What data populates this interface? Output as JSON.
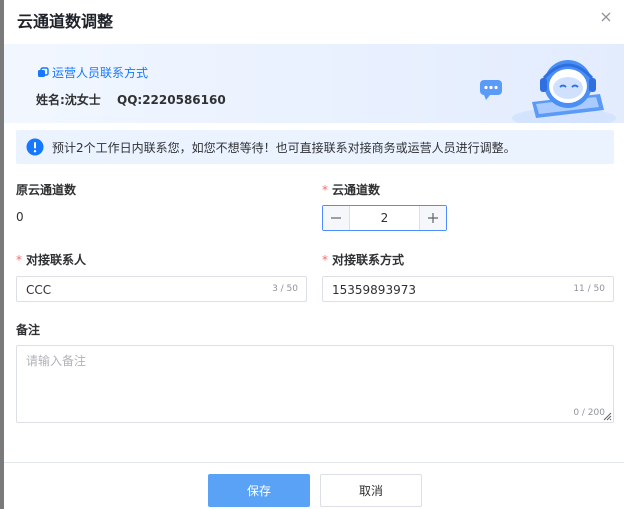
{
  "dialog": {
    "title": "云通道数调整"
  },
  "banner": {
    "contact_link": "运营人员联系方式",
    "name": "姓名:沈女士",
    "qq": "QQ:2220586160"
  },
  "notice": {
    "text": "预计2个工作日内联系您，如您不想等待！也可直接联系对接商务或运营人员进行调整。"
  },
  "form": {
    "original_label": "原云通道数",
    "original_value": "0",
    "channels_label": "云通道数",
    "channels_value": "2",
    "contact_person_label": "对接联系人",
    "contact_person_value": "CCC",
    "contact_person_count": "3 / 50",
    "contact_method_label": "对接联系方式",
    "contact_method_value": "15359893973",
    "contact_method_count": "11 / 50",
    "remark_label": "备注",
    "remark_placeholder": "请输入备注",
    "remark_count": "0 / 200",
    "required_mark": "*"
  },
  "footer": {
    "save_label": "保存",
    "cancel_label": "取消"
  },
  "colors": {
    "accent": "#1677ff",
    "primary_button": "#5aa2f5",
    "required": "#f56c6c",
    "notice_bg": "#eaf3ff"
  },
  "icons": [
    "close-icon",
    "link-icon",
    "robot-illustration",
    "info-icon",
    "minus-icon",
    "plus-icon",
    "resize-grip-icon"
  ]
}
